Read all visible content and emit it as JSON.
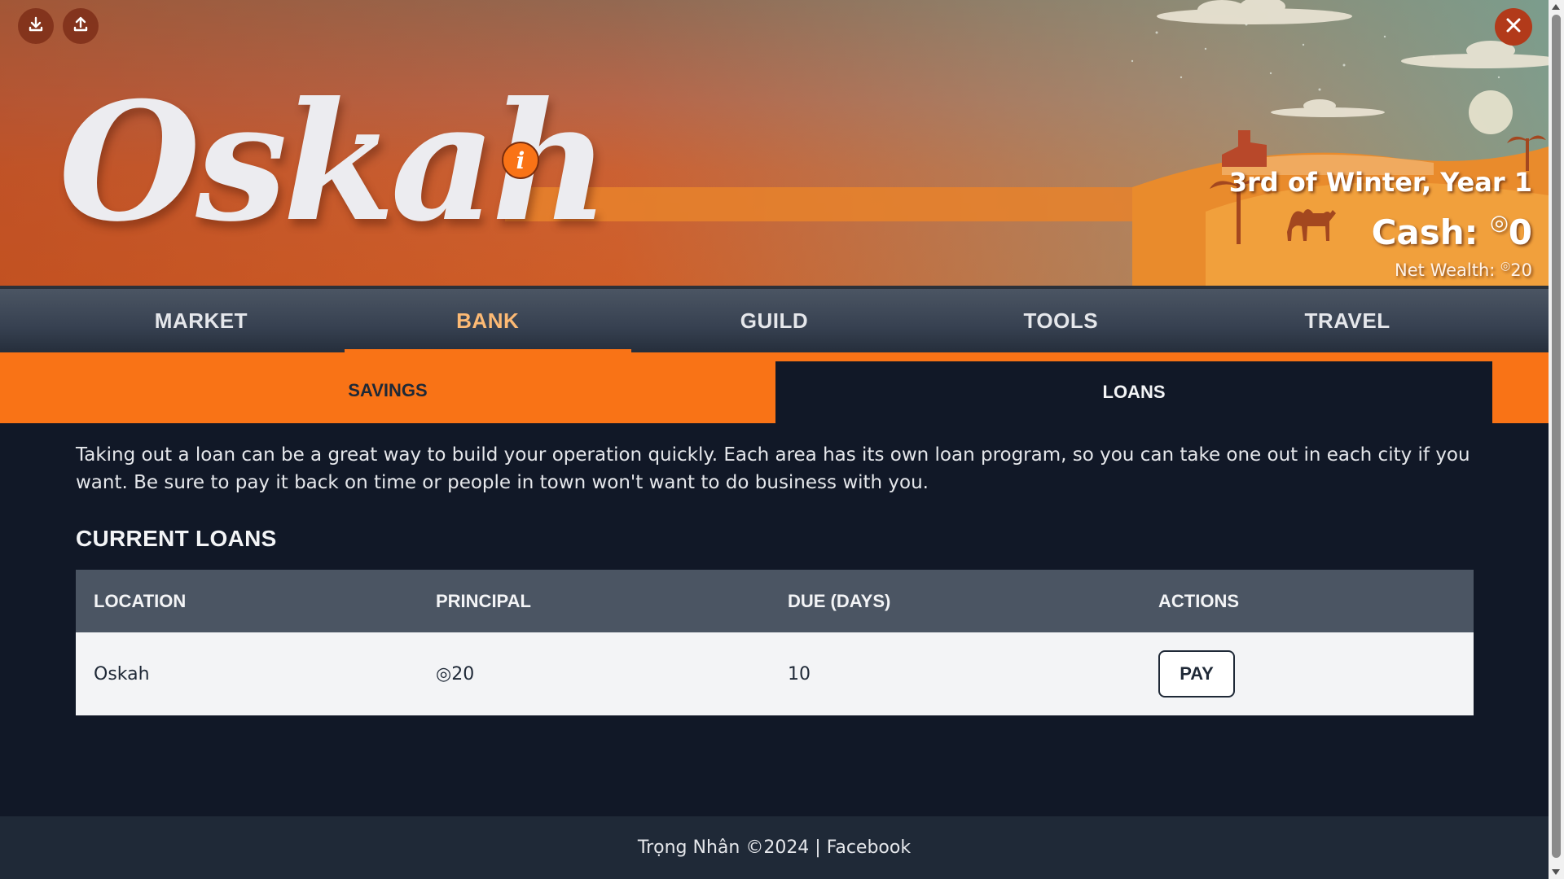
{
  "header": {
    "logo_text": "Oskah",
    "info_icon": "info-icon",
    "download_icon": "download-icon",
    "upload_icon": "upload-icon",
    "close_icon": "close-icon",
    "date": "3rd of Winter, Year 1",
    "cash_label": "Cash:",
    "coin_symbol": "◎",
    "cash_value": "0",
    "net_wealth_label": "Net Wealth:",
    "net_wealth_value": "20"
  },
  "nav": {
    "items": [
      {
        "label": "MARKET"
      },
      {
        "label": "BANK"
      },
      {
        "label": "GUILD"
      },
      {
        "label": "TOOLS"
      },
      {
        "label": "TRAVEL"
      }
    ],
    "active": "BANK"
  },
  "subtabs": {
    "savings": "SAVINGS",
    "loans": "LOANS",
    "active": "LOANS"
  },
  "main": {
    "intro": "Taking out a loan can be a great way to build your operation quickly. Each area has its own loan program, so you can take one out in each city if you want. Be sure to pay it back on time or people in town won't want to do business with you.",
    "section_title": "CURRENT LOANS",
    "table": {
      "headers": [
        "LOCATION",
        "PRINCIPAL",
        "DUE (DAYS)",
        "ACTIONS"
      ],
      "rows": [
        {
          "location": "Oskah",
          "principal": "◎20",
          "due": "10",
          "action": "PAY"
        }
      ]
    }
  },
  "footer": {
    "credit": "Trọng Nhân ©2024 |",
    "link": "Facebook"
  },
  "colors": {
    "accent": "#f97316",
    "active_nav_text": "#fdba74",
    "background": "#111827",
    "table_header": "#4b5563"
  }
}
